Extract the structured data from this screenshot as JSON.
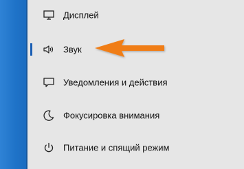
{
  "settings_nav": {
    "items": [
      {
        "label": "Дисплей",
        "icon": "monitor-icon",
        "selected": false
      },
      {
        "label": "Звук",
        "icon": "speaker-icon",
        "selected": true
      },
      {
        "label": "Уведомления и действия",
        "icon": "notification-icon",
        "selected": false
      },
      {
        "label": "Фокусировка внимания",
        "icon": "moon-icon",
        "selected": false
      },
      {
        "label": "Питание и спящий режим",
        "icon": "power-icon",
        "selected": false
      }
    ]
  },
  "colors": {
    "accent": "#1a5fb4",
    "pointer_arrow": "#f07d12",
    "left_strip": "#1f73c8",
    "panel_bg": "#e6e6e6"
  }
}
